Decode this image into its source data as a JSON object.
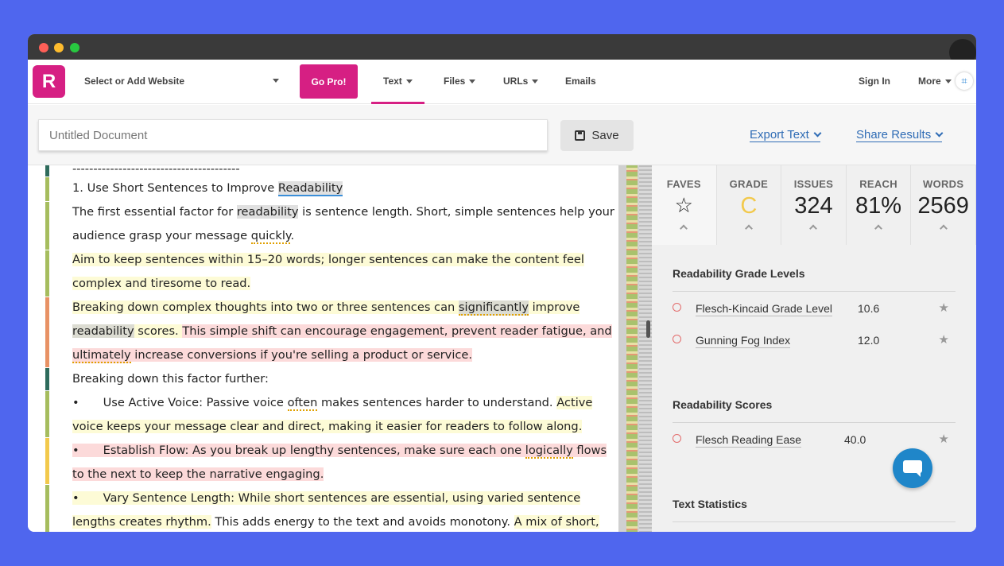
{
  "nav": {
    "logo": "R",
    "site_select": "Select or Add Website",
    "go_pro": "Go Pro!",
    "text": "Text",
    "files": "Files",
    "urls": "URLs",
    "emails": "Emails",
    "sign_in": "Sign In",
    "more": "More"
  },
  "docbar": {
    "title_placeholder": "Untitled Document",
    "save": "Save",
    "export": "Export Text",
    "share": "Share Results"
  },
  "editor": {
    "dashes": "----------------------------------------",
    "l1a": "1. Use Short Sentences to Improve ",
    "l1b": "Readability",
    "l2a": "The first essential factor for ",
    "l2b": "readability",
    "l2c": " is sentence length. Short, simple sentences help your",
    "l3a": "audience grasp your message ",
    "l3b": "quickly",
    "l3c": ".",
    "l4": "Aim to keep sentences within 15–20 words; longer sentences can make the content feel",
    "l5": "complex and tiresome to read.",
    "l6a": "Breaking down complex thoughts into two or three sentences can ",
    "l6b": "significantly",
    "l6c": " improve",
    "l7a": "readability",
    "l7b": " scores. ",
    "l7c": "This simple shift can encourage engagement, prevent reader fatigue, and",
    "l8a": "ultimately",
    "l8b": " increase conversions if you're selling a product or service.",
    "l9": "Breaking down this factor further:",
    "bullet": "•",
    "l10a": "Use Active Voice: Passive voice ",
    "l10b": "often",
    "l10c": " makes sentences harder to understand. ",
    "l10d": "Active",
    "l11": "voice keeps your message clear and direct, making it easier for readers to follow along.",
    "l12a": "Establish Flow: As you break up lengthy sentences, make sure each one ",
    "l12b": "logically",
    "l12c": " flows",
    "l13": "to the next to keep the narrative engaging.",
    "l14": "Vary Sentence Length: While short sentences are essential, using varied sentence",
    "l15a": "lengths creates rhythm.",
    "l15b": " This adds energy to the text and avoids monotony. ",
    "l15c": "A mix of short,"
  },
  "stats": {
    "faves_label": "FAVES",
    "grade_label": "GRADE",
    "grade_value": "C",
    "issues_label": "ISSUES",
    "issues_value": "324",
    "reach_label": "REACH",
    "reach_value": "81%",
    "words_label": "WORDS",
    "words_value": "2569"
  },
  "grade_levels": {
    "title": "Readability Grade Levels",
    "rows": [
      {
        "name": "Flesch-Kincaid Grade Level",
        "value": "10.6"
      },
      {
        "name": "Gunning Fog Index",
        "value": "12.0"
      }
    ]
  },
  "scores": {
    "title": "Readability Scores",
    "rows": [
      {
        "name": "Flesch Reading Ease",
        "value": "40.0"
      }
    ]
  },
  "text_stats": {
    "title": "Text Statistics"
  },
  "colors": {
    "brand": "#d61f83",
    "background": "#4f66ee",
    "link": "#2f6cb5",
    "grade": "#f2c94c"
  }
}
